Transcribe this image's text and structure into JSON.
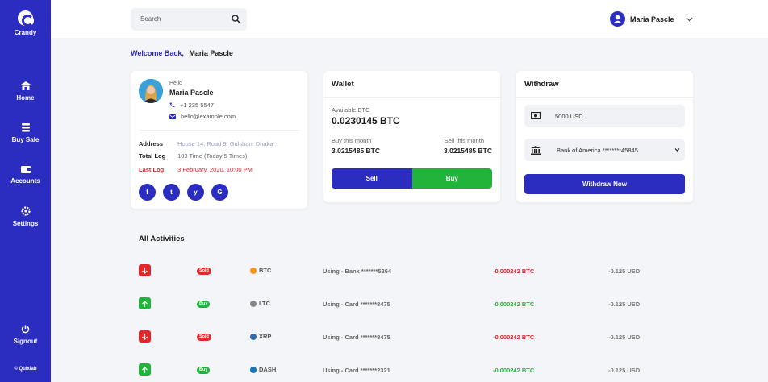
{
  "app": {
    "name": "Crandy",
    "copyright": "© Quixlab"
  },
  "sidebar": {
    "items": [
      {
        "label": "Home",
        "icon": "home-icon"
      },
      {
        "label": "Buy Sale",
        "icon": "stack-icon"
      },
      {
        "label": "Accounts",
        "icon": "wallet-icon"
      },
      {
        "label": "Settings",
        "icon": "gear-icon"
      }
    ],
    "signout": {
      "label": "Signout",
      "icon": "power-icon"
    }
  },
  "header": {
    "search_placeholder": "Search",
    "user_name": "Maria Pascle"
  },
  "welcome": {
    "prefix": "Welcome Back,",
    "name": "Maria Pascle"
  },
  "profile": {
    "greeting": "Hello",
    "name": "Maria Pascle",
    "phone": "+1 235 5547",
    "email": "hello@example.com",
    "address_label": "Address",
    "address": "House 14, Road 9, Gulshan, Dhaka",
    "total_log_label": "Total Log",
    "total_log": "103 Time (Today 5 Times)",
    "last_log_label": "Last Log",
    "last_log": "3 February, 2020, 10:00 PM",
    "socials": [
      "f",
      "t",
      "y",
      "G"
    ]
  },
  "wallet": {
    "title": "Wallet",
    "available_label": "Available BTC",
    "available_value": "0.0230145 BTC",
    "buy_label": "Buy this month",
    "buy_value": "3.0215485 BTC",
    "sell_label": "Sell this month",
    "sell_value": "3.0215485 BTC",
    "sell_button": "Sell",
    "buy_button": "Buy"
  },
  "withdraw": {
    "title": "Withdraw",
    "amount": "5000 USD",
    "bank": "Bank of America ********45845",
    "button": "Withdraw Now"
  },
  "activities": {
    "title": "All Activities",
    "rows": [
      {
        "direction": "down",
        "badge": "Sold",
        "coin": "BTC",
        "coin_color": "#f7931a",
        "desc": "Using - Bank *******5264",
        "amount": "-0.000242 BTC",
        "usd": "-0.125 USD"
      },
      {
        "direction": "up",
        "badge": "Buy",
        "coin": "LTC",
        "coin_color": "#8a8a8a",
        "desc": "Using - Card *******8475",
        "amount": "-0.000242 BTC",
        "usd": "-0.125 USD"
      },
      {
        "direction": "down",
        "badge": "Sold",
        "coin": "XRP",
        "coin_color": "#346aa9",
        "desc": "Using - Card *******8475",
        "amount": "-0.000242 BTC",
        "usd": "-0.125 USD"
      },
      {
        "direction": "up",
        "badge": "Buy",
        "coin": "DASH",
        "coin_color": "#1c75bc",
        "desc": "Using - Card *******2321",
        "amount": "-0.000242 BTC",
        "usd": "-0.125 USD"
      }
    ]
  },
  "colors": {
    "primary": "#2b2dc1",
    "success": "#22b33a",
    "danger": "#e0282a"
  }
}
